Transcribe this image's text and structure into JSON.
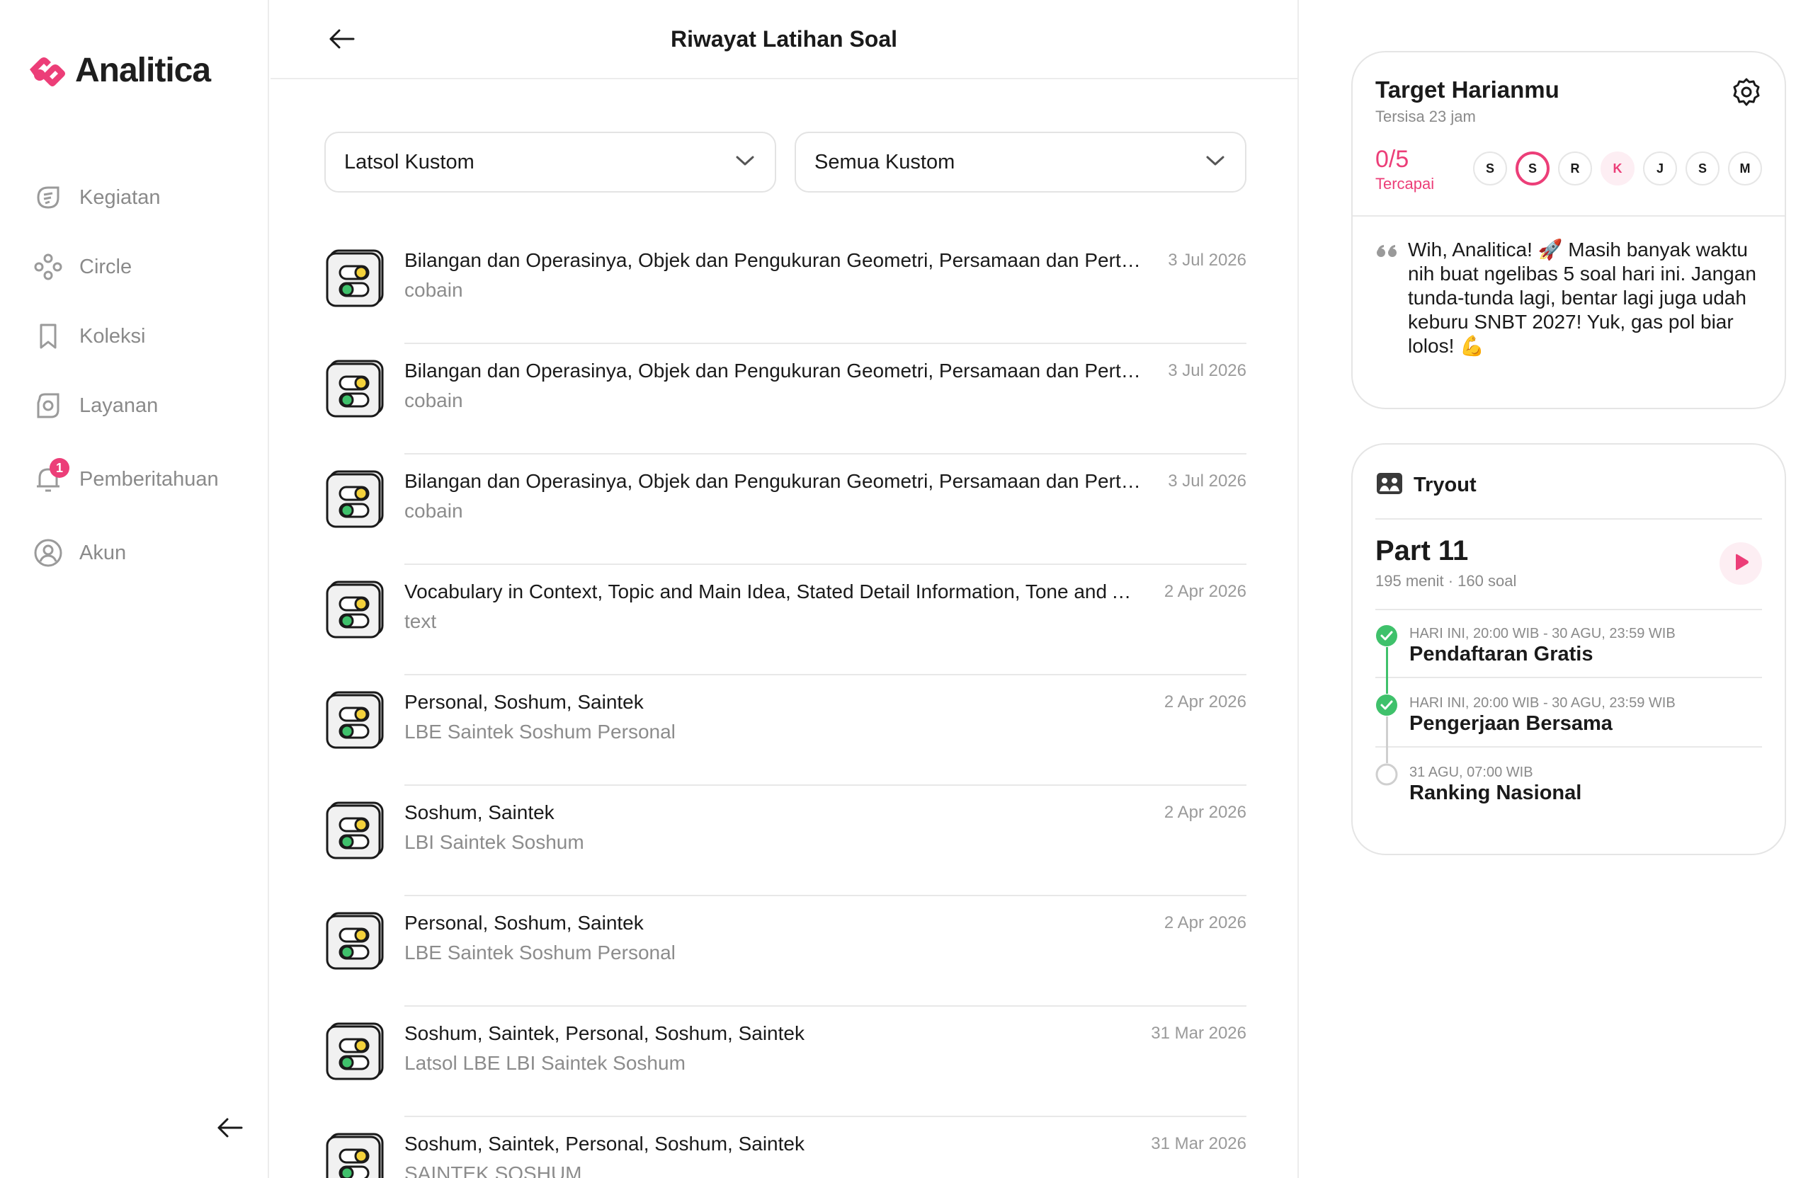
{
  "brand": {
    "name": "Analitica",
    "color": "#ec3e78"
  },
  "sidebar": {
    "items": [
      {
        "label": "Kegiatan",
        "icon": "activity-icon"
      },
      {
        "label": "Circle",
        "icon": "circle-group-icon"
      },
      {
        "label": "Koleksi",
        "icon": "bookmark-icon"
      },
      {
        "label": "Layanan",
        "icon": "service-icon"
      },
      {
        "label": "Pemberitahuan",
        "icon": "bell-icon",
        "badge": "1"
      },
      {
        "label": "Akun",
        "icon": "account-icon"
      }
    ]
  },
  "header": {
    "title": "Riwayat Latihan Soal"
  },
  "filters": {
    "type": "Latsol Kustom",
    "scope": "Semua Kustom"
  },
  "history": [
    {
      "title": "Bilangan dan Operasinya, Objek dan Pengukuran Geometri, Persamaan dan Pertidaksamaan",
      "subtitle": "cobain",
      "date": "3 Jul 2026"
    },
    {
      "title": "Bilangan dan Operasinya, Objek dan Pengukuran Geometri, Persamaan dan Pertidaksamaan",
      "subtitle": "cobain",
      "date": "3 Jul 2026"
    },
    {
      "title": "Bilangan dan Operasinya, Objek dan Pengukuran Geometri, Persamaan dan Pertidaksamaan",
      "subtitle": "cobain",
      "date": "3 Jul 2026"
    },
    {
      "title": "Vocabulary in Context, Topic and Main Idea, Stated Detail Information, Tone and Attitude",
      "subtitle": "text",
      "date": "2 Apr 2026"
    },
    {
      "title": "Personal, Soshum, Saintek",
      "subtitle": "LBE Saintek Soshum Personal",
      "date": "2 Apr 2026"
    },
    {
      "title": "Soshum, Saintek",
      "subtitle": "LBI Saintek Soshum",
      "date": "2 Apr 2026"
    },
    {
      "title": "Personal, Soshum, Saintek",
      "subtitle": "LBE Saintek Soshum Personal",
      "date": "2 Apr 2026"
    },
    {
      "title": "Soshum, Saintek, Personal, Soshum, Saintek",
      "subtitle": "Latsol LBE LBI Saintek Soshum",
      "date": "31 Mar 2026"
    },
    {
      "title": "Soshum, Saintek, Personal, Soshum, Saintek",
      "subtitle": "SAINTEK SOSHUM",
      "date": "31 Mar 2026"
    }
  ],
  "target": {
    "title": "Target Harianmu",
    "remaining": "Tersisa 23 jam",
    "progress": "0/5",
    "progress_label": "Tercapai",
    "days": [
      "S",
      "S",
      "R",
      "K",
      "J",
      "S",
      "M"
    ],
    "quote": "Wih, Analitica! 🚀 Masih banyak waktu nih buat ngelibas 5 soal hari ini. Jangan tunda-tunda lagi, bentar lagi juga udah keburu SNBT 2027! Yuk, gas pol biar lolos! 💪"
  },
  "tryout": {
    "title": "Tryout",
    "part": "Part 11",
    "meta": "195 menit · 160 soal",
    "timeline": [
      {
        "time": "HARI INI, 20:00 WIB - 30 AGU, 23:59 WIB",
        "title": "Pendaftaran Gratis",
        "done": true
      },
      {
        "time": "HARI INI, 20:00 WIB - 30 AGU, 23:59 WIB",
        "title": "Pengerjaan Bersama",
        "done": true
      },
      {
        "time": "31 AGU, 07:00 WIB",
        "title": "Ranking Nasional",
        "done": false
      }
    ]
  }
}
